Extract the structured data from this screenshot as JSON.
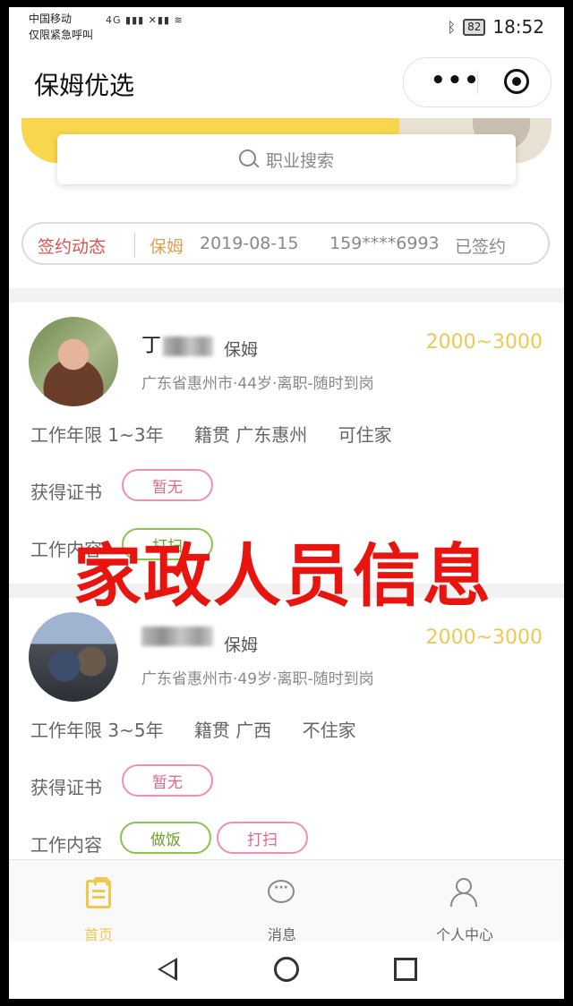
{
  "status_bar": {
    "carrier_line1": "中国移动",
    "carrier_line2": "仅限紧急呼叫",
    "signal_label": "4G ▮▮▮ ✕▮▮ ≋",
    "battery": "82",
    "time": "18:52"
  },
  "header": {
    "title": "保姆优选",
    "more_label": "•••"
  },
  "search": {
    "placeholder": "职业搜索"
  },
  "ticker": {
    "label": "签约动态",
    "role": "保姆",
    "date": "2019-08-15",
    "phone": "159****6993",
    "status": "已签约"
  },
  "nannies": [
    {
      "surname": "丁",
      "role": "保姆",
      "salary": "2000~3000",
      "info": "广东省惠州市·44岁·离职-随时到岗",
      "experience": "工作年限 1~3年",
      "native": "籍贯 广东惠州",
      "live_in": "可住家",
      "cert_label": "获得证书",
      "cert": "暂无",
      "work_label": "工作内容",
      "work_items": [
        "打扫"
      ]
    },
    {
      "surname": "",
      "role": "保姆",
      "salary": "2000~3000",
      "info": "广东省惠州市·49岁·离职-随时到岗",
      "experience": "工作年限 3~5年",
      "native": "籍贯 广西",
      "live_in": "不住家",
      "cert_label": "获得证书",
      "cert": "暂无",
      "work_label": "工作内容",
      "work_items": [
        "做饭",
        "打扫"
      ]
    }
  ],
  "watermark": "家政人员信息",
  "tabbar": {
    "items": [
      {
        "label": "首页",
        "icon": "home-clipboard-icon",
        "active": true
      },
      {
        "label": "消息",
        "icon": "message-icon",
        "active": false
      },
      {
        "label": "个人中心",
        "icon": "user-icon",
        "active": false
      }
    ]
  },
  "colors": {
    "accent": "#f0c850",
    "ticker_label": "#d9534f",
    "pill_pink": "#e3668c",
    "pill_green": "#6aa32a",
    "watermark": "#e8140f"
  }
}
